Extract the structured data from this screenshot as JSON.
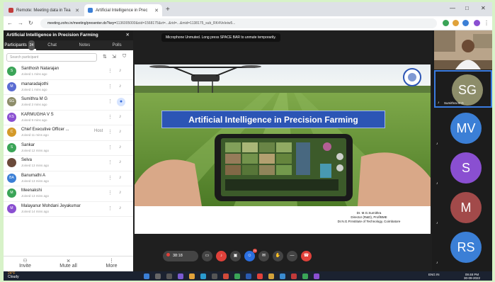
{
  "browser": {
    "tabs": [
      {
        "label": "Remote: Meeting data in Tea",
        "color": "#c23b3b"
      },
      {
        "label": "Artificial Intelligence in Prec",
        "color": "#3b7fd6"
      }
    ],
    "new_tab": "+",
    "url_prefix": "meeting.zoho.in/meeting/presenter.do?key=",
    "url_rest": "1136005000&xid=1568175&vt=...&rid=...&mid=1138175_sub_RK4VeIeiw5...",
    "window_controls": [
      "—",
      "□",
      "✕"
    ]
  },
  "panel": {
    "title": "Artificial Intelligence in Precision Farming",
    "close": "✕",
    "tabs": [
      {
        "label": "Participants",
        "badge": "24",
        "active": true
      },
      {
        "label": "Chat",
        "active": false
      },
      {
        "label": "Notes",
        "active": false
      },
      {
        "label": "Polls",
        "active": false
      }
    ],
    "search_placeholder": "Search participant",
    "participants": [
      {
        "initials": "S",
        "name": "Santhosh Natarajan",
        "time": "Joined 1 mins ago",
        "color": "#3aa457"
      },
      {
        "initials": "M",
        "name": "manaradajothi",
        "time": "Joined 1 mins ago",
        "color": "#5a6bd2"
      },
      {
        "initials": "SG",
        "name": "Sumithra M G",
        "time": "Joined 2 mins ago",
        "color": "#8d8d6a",
        "live": true
      },
      {
        "initials": "KS",
        "name": "KARMUGHA V S",
        "time": "Joined 9 mins ago",
        "color": "#8a4fd1"
      },
      {
        "initials": "C",
        "name": "Chief Executive Officer ...",
        "time": "Joined 11 mins ago",
        "color": "#d49a2a",
        "extra": "Host"
      },
      {
        "initials": "S",
        "name": "Sankar",
        "time": "Joined 12 mins ago",
        "color": "#3aa457"
      },
      {
        "initials": "",
        "name": "Selva",
        "time": "Joined 13 mins ago",
        "color": "#6b4a3a"
      },
      {
        "initials": "BA",
        "name": "Banumathi A",
        "time": "Joined 13 mins ago",
        "color": "#3b7fd6"
      },
      {
        "initials": "M",
        "name": "Meenakshi",
        "time": "Joined 13 mins ago",
        "color": "#3aa457"
      },
      {
        "initials": "M",
        "name": "Malayanur Mohdani Jeyakumar",
        "time": "Joined 14 mins ago",
        "color": "#8a4fd1"
      }
    ],
    "footer": [
      {
        "icon": "person-plus",
        "label": "Invite"
      },
      {
        "icon": "mute",
        "label": "Mute all"
      },
      {
        "icon": "more",
        "label": "More"
      }
    ]
  },
  "stage": {
    "toast": "Microphone Unmuted. Long press SPACE BAR to unmute temporarily.",
    "slide_title": "Artificial Intelligence in  Precision Farming",
    "credit_lines": [
      "Dr. M.G.Sumithra",
      "Director (R&D), Prof/BME",
      "Dr.N.G.P.Institute of Technology, Coimbatore"
    ],
    "recording_time": "38:18",
    "reaction_count": "24"
  },
  "tiles": [
    {
      "initials": "SG",
      "name": "Sumithra M G",
      "color": "#8d8d6a",
      "highlight": true
    },
    {
      "initials": "MV",
      "name": "",
      "color": "#3b7fd6"
    },
    {
      "initials": "S",
      "name": "",
      "color": "#8a4fd1"
    },
    {
      "initials": "M",
      "name": "",
      "color": "#a24a4a"
    },
    {
      "initials": "RS",
      "name": "",
      "color": "#3b7fd6"
    }
  ],
  "taskbar": {
    "weather_temp": "24°F",
    "weather_text": "Cloudy",
    "lang": "ENG IN",
    "time": "09:48 PM",
    "date": "30-09-2022"
  },
  "colors": {
    "accent": "#2c55b5",
    "red": "#e0413a",
    "highlight": "#3a7be0"
  }
}
